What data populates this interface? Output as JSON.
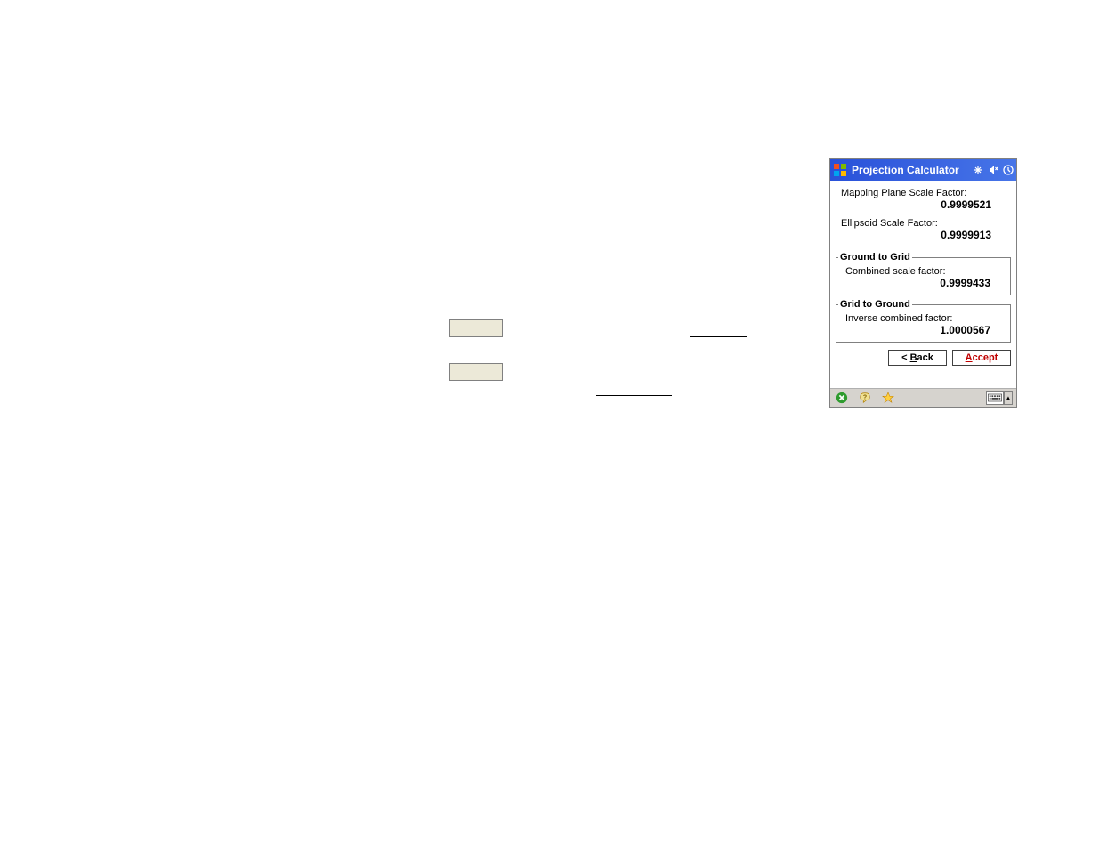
{
  "pda": {
    "title": "Projection Calculator",
    "mapping_plane": {
      "label": "Mapping Plane Scale Factor:",
      "value": "0.9999521"
    },
    "ellipsoid": {
      "label": "Ellipsoid Scale Factor:",
      "value": "0.9999913"
    },
    "ground_to_grid": {
      "legend": "Ground to Grid",
      "label": "Combined scale factor:",
      "value": "0.9999433"
    },
    "grid_to_ground": {
      "legend": "Grid to Ground",
      "label": "Inverse combined factor:",
      "value": "1.0000567"
    },
    "buttons": {
      "back_prefix": "< ",
      "back_u": "B",
      "back_rest": "ack",
      "accept_u": "A",
      "accept_rest": "ccept"
    }
  }
}
